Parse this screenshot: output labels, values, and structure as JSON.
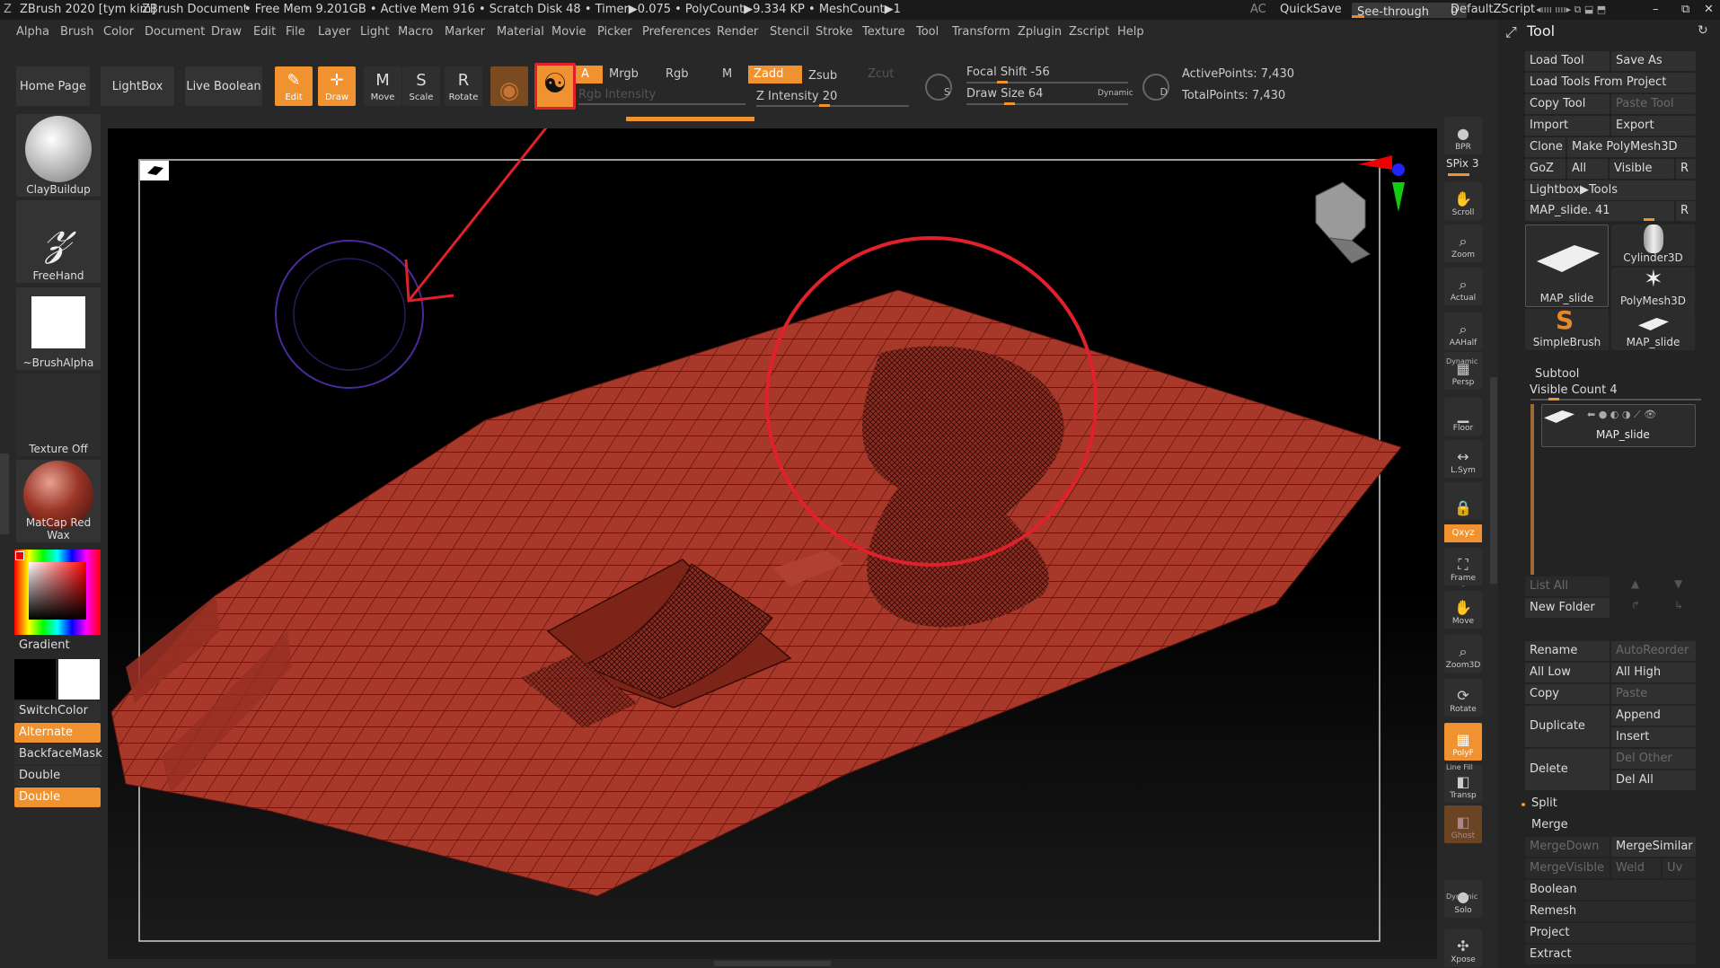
{
  "titlebar": {
    "app": "ZBrush 2020 [tym kim]",
    "doc": "ZBrush Document",
    "stats": "• Free Mem 9.201GB • Active Mem 916 • Scratch Disk 48 •  Timer▶0.075 • PolyCount▶9.334 KP • MeshCount▶1",
    "ac": "AC",
    "quicksave": "QuickSave",
    "seethrough": "See-through",
    "seethrough_value": "0",
    "zscript": "DefaultZScript"
  },
  "menu": [
    "Alpha",
    "Brush",
    "Color",
    "Document",
    "Draw",
    "Edit",
    "File",
    "Layer",
    "Light",
    "Macro",
    "Marker",
    "Material",
    "Movie",
    "Picker",
    "Preferences",
    "Render",
    "Stencil",
    "Stroke",
    "Texture",
    "Tool",
    "Transform",
    "Zplugin",
    "Zscript",
    "Help"
  ],
  "shelf": {
    "home": "Home Page",
    "lightbox": "LightBox",
    "liveboolean": "Live Boolean",
    "tools": [
      {
        "label": "Edit",
        "icon": "✎",
        "on": true
      },
      {
        "label": "Draw",
        "icon": "✛",
        "on": true
      },
      {
        "label": "Move",
        "icon": "M",
        "on": false
      },
      {
        "label": "Scale",
        "icon": "S",
        "on": false
      },
      {
        "label": "Rotate",
        "icon": "R",
        "on": false
      }
    ],
    "a": "A",
    "mrgb": "Mrgb",
    "rgb": "Rgb",
    "m": "M",
    "zadd": "Zadd",
    "zsub": "Zsub",
    "zcut": "Zcut",
    "rgb_intensity": "Rgb Intensity",
    "z_intensity": "Z Intensity 20",
    "focal_shift": "Focal Shift -56",
    "draw_size": "Draw Size 64",
    "dynamic": "Dynamic",
    "s_label": "S",
    "d_label": "D",
    "active_points": "ActivePoints: 7,430",
    "total_points": "TotalPoints: 7,430"
  },
  "left": {
    "brush": "ClayBuildup",
    "stroke": "FreeHand",
    "alpha": "~BrushAlpha",
    "texture": "Texture Off",
    "material": "MatCap Red Wax",
    "gradient": "Gradient",
    "switchcolor": "SwitchColor",
    "alternate": "Alternate",
    "backfacemask": "BackfaceMask",
    "double1": "Double",
    "double2": "Double"
  },
  "rightshelf": [
    {
      "label": "BPR",
      "icon": "●"
    },
    {
      "label": "SPix 3",
      "icon": ""
    },
    {
      "label": "Scroll",
      "icon": "✋"
    },
    {
      "label": "Zoom",
      "icon": "⌕"
    },
    {
      "label": "Actual",
      "icon": "⌕"
    },
    {
      "label": "AAHalf",
      "icon": "⌕"
    },
    {
      "label": "Persp",
      "icon": "▦"
    },
    {
      "label": "Floor",
      "icon": "▁"
    },
    {
      "label": "L.Sym",
      "icon": "↔"
    },
    {
      "label": "",
      "icon": "🔒"
    },
    {
      "label": "Qxyz",
      "icon": ""
    },
    {
      "label": "Frame",
      "icon": "⛶"
    },
    {
      "label": "Move",
      "icon": "✋"
    },
    {
      "label": "Zoom3D",
      "icon": "⌕"
    },
    {
      "label": "Rotate",
      "icon": "⟳"
    },
    {
      "label": "PolyF",
      "icon": "▦"
    },
    {
      "label": "Transp",
      "icon": "◧"
    },
    {
      "label": "Ghost",
      "icon": "◧"
    },
    {
      "label": "Solo",
      "icon": "●"
    },
    {
      "label": "Xpose",
      "icon": "✣"
    }
  ],
  "rs_extra": {
    "dynamic1": "Dynamic",
    "linefill": "Line Fill",
    "dynamic2": "Dynamic"
  },
  "tool": {
    "header": "Tool",
    "load_tool": "Load Tool",
    "save_as": "Save As",
    "load_from_project": "Load Tools From Project",
    "copy_tool": "Copy Tool",
    "paste_tool": "Paste Tool",
    "import": "Import",
    "export": "Export",
    "clone": "Clone",
    "make_polymesh": "Make PolyMesh3D",
    "goz": "GoZ",
    "all": "All",
    "visible": "Visible",
    "r": "R",
    "lightbox_tools": "Lightbox▶Tools",
    "map_slide_slider": "MAP_slide. 41",
    "r2": "R",
    "tiles": [
      "MAP_slide",
      "Cylinder3D",
      "PolyMesh3D",
      "SimpleBrush",
      "MAP_slide"
    ],
    "subtool": "Subtool",
    "visible_count": "Visible Count 4",
    "subtool_item": "MAP_slide",
    "list_all": "List All",
    "new_folder": "New Folder",
    "rename": "Rename",
    "autoreorder": "AutoReorder",
    "all_low": "All Low",
    "all_high": "All High",
    "copy": "Copy",
    "paste": "Paste",
    "duplicate": "Duplicate",
    "append": "Append",
    "insert": "Insert",
    "delete": "Delete",
    "del_other": "Del Other",
    "del_all": "Del All",
    "split": "Split",
    "merge": "Merge",
    "mergedown": "MergeDown",
    "mergesimilar": "MergeSimilar",
    "mergevisible": "MergeVisible",
    "weld": "Weld",
    "uv": "Uv",
    "boolean": "Boolean",
    "remesh": "Remesh",
    "project": "Project",
    "extract": "Extract"
  },
  "colors": {
    "accent": "#f0922f",
    "mesh": "#a8382a",
    "annotation": "#e0202a"
  }
}
